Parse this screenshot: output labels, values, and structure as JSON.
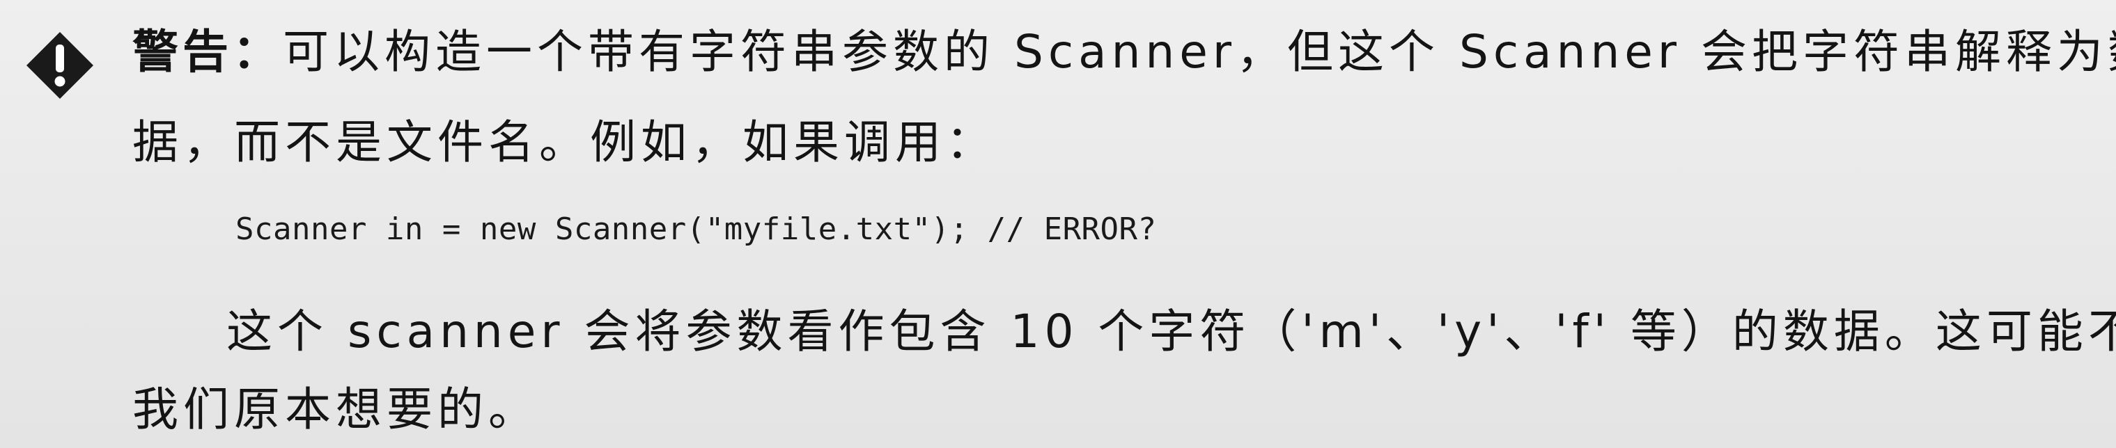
{
  "warning": {
    "icon": "warning-diamond-icon",
    "label": "警告：",
    "text_line1": "可以构造一个带有字符串参数的 Scanner，但这个 Scanner 会把字符串解释为数",
    "text_line2": "据，而不是文件名。例如，如果调用：",
    "code": "Scanner in = new Scanner(\"myfile.txt\"); // ERROR?",
    "explanation_line1": "这个 scanner 会将参数看作包含 10 个字符（'m'、'y'、'f' 等）的数据。这可能不是",
    "explanation_line2": "我们原本想要的。"
  }
}
